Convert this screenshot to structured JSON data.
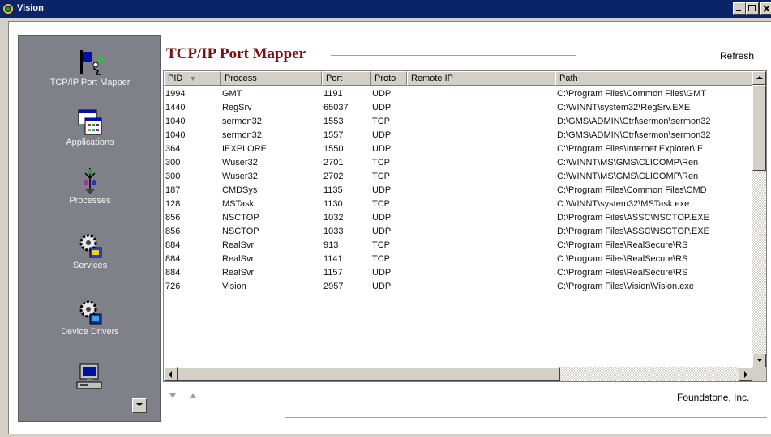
{
  "window": {
    "title": "Vision"
  },
  "header": {
    "title": "TCP/IP Port Mapper",
    "refresh_label": "Refresh"
  },
  "sidebar": {
    "items": [
      {
        "label": "TCP/IP Port Mapper",
        "icon": "port-mapper-icon"
      },
      {
        "label": "Applications",
        "icon": "applications-icon"
      },
      {
        "label": "Processes",
        "icon": "processes-icon"
      },
      {
        "label": "Services",
        "icon": "services-icon"
      },
      {
        "label": "Device Drivers",
        "icon": "device-drivers-icon"
      },
      {
        "label": "",
        "icon": "computer-icon"
      }
    ]
  },
  "table": {
    "columns": [
      "PID",
      "Process",
      "Port",
      "Proto",
      "Remote IP",
      "Path"
    ],
    "sorted_column": "PID",
    "rows": [
      {
        "pid": "1994",
        "process": "GMT",
        "port": "1191",
        "proto": "UDP",
        "remote_ip": "",
        "path": "C:\\Program Files\\Common Files\\GMT"
      },
      {
        "pid": "1440",
        "process": "RegSrv",
        "port": "65037",
        "proto": "UDP",
        "remote_ip": "",
        "path": "C:\\WINNT\\system32\\RegSrv.EXE"
      },
      {
        "pid": "1040",
        "process": "sermon32",
        "port": "1553",
        "proto": "TCP",
        "remote_ip": "",
        "path": "D:\\GMS\\ADMIN\\Ctrl\\sermon\\sermon32"
      },
      {
        "pid": "1040",
        "process": "sermon32",
        "port": "1557",
        "proto": "UDP",
        "remote_ip": "",
        "path": "D:\\GMS\\ADMIN\\Ctrl\\sermon\\sermon32"
      },
      {
        "pid": "364",
        "process": "IEXPLORE",
        "port": "1550",
        "proto": "UDP",
        "remote_ip": "",
        "path": "C:\\Program Files\\Internet Explorer\\IE"
      },
      {
        "pid": "300",
        "process": "Wuser32",
        "port": "2701",
        "proto": "TCP",
        "remote_ip": "",
        "path": "C:\\WINNT\\MS\\GMS\\CLICOMP\\Ren"
      },
      {
        "pid": "300",
        "process": "Wuser32",
        "port": "2702",
        "proto": "TCP",
        "remote_ip": "",
        "path": "C:\\WINNT\\MS\\GMS\\CLICOMP\\Ren"
      },
      {
        "pid": "187",
        "process": "CMDSys",
        "port": "1135",
        "proto": "UDP",
        "remote_ip": "",
        "path": "C:\\Program Files\\Common Files\\CMD"
      },
      {
        "pid": "128",
        "process": "MSTask",
        "port": "1130",
        "proto": "TCP",
        "remote_ip": "",
        "path": "C:\\WINNT\\system32\\MSTask.exe"
      },
      {
        "pid": "856",
        "process": "NSCTOP",
        "port": "1032",
        "proto": "UDP",
        "remote_ip": "",
        "path": "D:\\Program Files\\ASSC\\NSCTOP.EXE"
      },
      {
        "pid": "856",
        "process": "NSCTOP",
        "port": "1033",
        "proto": "UDP",
        "remote_ip": "",
        "path": "D:\\Program Files\\ASSC\\NSCTOP.EXE"
      },
      {
        "pid": "884",
        "process": "RealSvr",
        "port": "913",
        "proto": "TCP",
        "remote_ip": "",
        "path": "C:\\Program Files\\RealSecure\\RS"
      },
      {
        "pid": "884",
        "process": "RealSvr",
        "port": "1141",
        "proto": "TCP",
        "remote_ip": "",
        "path": "C:\\Program Files\\RealSecure\\RS"
      },
      {
        "pid": "884",
        "process": "RealSvr",
        "port": "1157",
        "proto": "UDP",
        "remote_ip": "",
        "path": "C:\\Program Files\\RealSecure\\RS"
      },
      {
        "pid": "726",
        "process": "Vision",
        "port": "2957",
        "proto": "UDP",
        "remote_ip": "",
        "path": "C:\\Program Files\\Vision\\Vision.exe"
      }
    ]
  },
  "footer": {
    "company": "Foundstone, Inc."
  }
}
